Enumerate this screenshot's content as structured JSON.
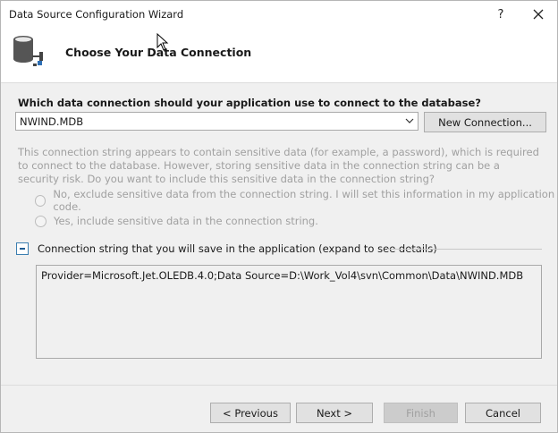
{
  "window": {
    "title": "Data Source Configuration Wizard",
    "help_label": "?"
  },
  "header": {
    "title": "Choose Your Data Connection"
  },
  "connection": {
    "question": "Which data connection should your application use to connect to the database?",
    "selected": "NWIND.MDB",
    "new_connection_label": "New Connection..."
  },
  "sensitive": {
    "warning": "This connection string appears to contain sensitive data (for example, a password), which is required to connect to the database. However, storing sensitive data in the connection string can be a security risk. Do you want to include this sensitive data in the connection string?",
    "option_exclude": "No, exclude sensitive data from the connection string. I will set this information in my application code.",
    "option_include": "Yes, include sensitive data in the connection string."
  },
  "details": {
    "label": "Connection string that you will save in the application (expand to see details)",
    "connection_string": "Provider=Microsoft.Jet.OLEDB.4.0;Data Source=D:\\Work_Vol4\\svn\\Common\\Data\\NWIND.MDB"
  },
  "footer": {
    "previous_label": "< Previous",
    "next_label": "Next >",
    "finish_label": "Finish",
    "cancel_label": "Cancel"
  }
}
